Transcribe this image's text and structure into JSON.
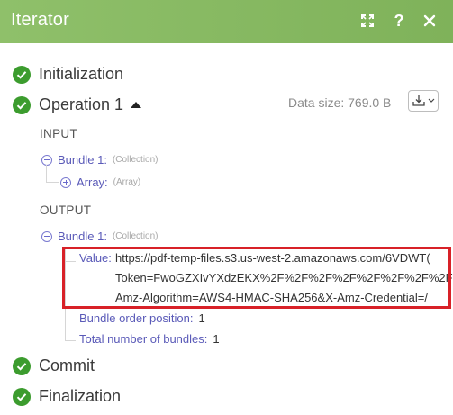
{
  "header": {
    "title": "Iterator",
    "help_label": "?",
    "color": "#86b963"
  },
  "steps": {
    "initialization": "Initialization",
    "operation": "Operation 1",
    "commit": "Commit",
    "finalization": "Finalization"
  },
  "operation": {
    "data_size": "Data size: 769.0 B"
  },
  "input": {
    "section_label": "INPUT",
    "bundle_key": "Bundle 1:",
    "bundle_type": "(Collection)",
    "array_key": "Array:",
    "array_type": "(Array)"
  },
  "output": {
    "section_label": "OUTPUT",
    "bundle_key": "Bundle 1:",
    "bundle_type": "(Collection)",
    "value_key": "Value:",
    "value_lines": [
      "https://pdf-temp-files.s3.us-west-2.amazonaws.com/6VDWT(",
      "Token=FwoGZXIvYXdzEKX%2F%2F%2F%2F%2F%2F%2F%2F%2F%2F%",
      "Amz-Algorithm=AWS4-HMAC-SHA256&X-Amz-Credential=/"
    ],
    "order_key": "Bundle order position:",
    "order_value": "1",
    "total_key": "Total number of bundles:",
    "total_value": "1"
  },
  "colors": {
    "success": "#3c9c2e",
    "highlight": "#d82128",
    "key": "#5a5ab8"
  }
}
